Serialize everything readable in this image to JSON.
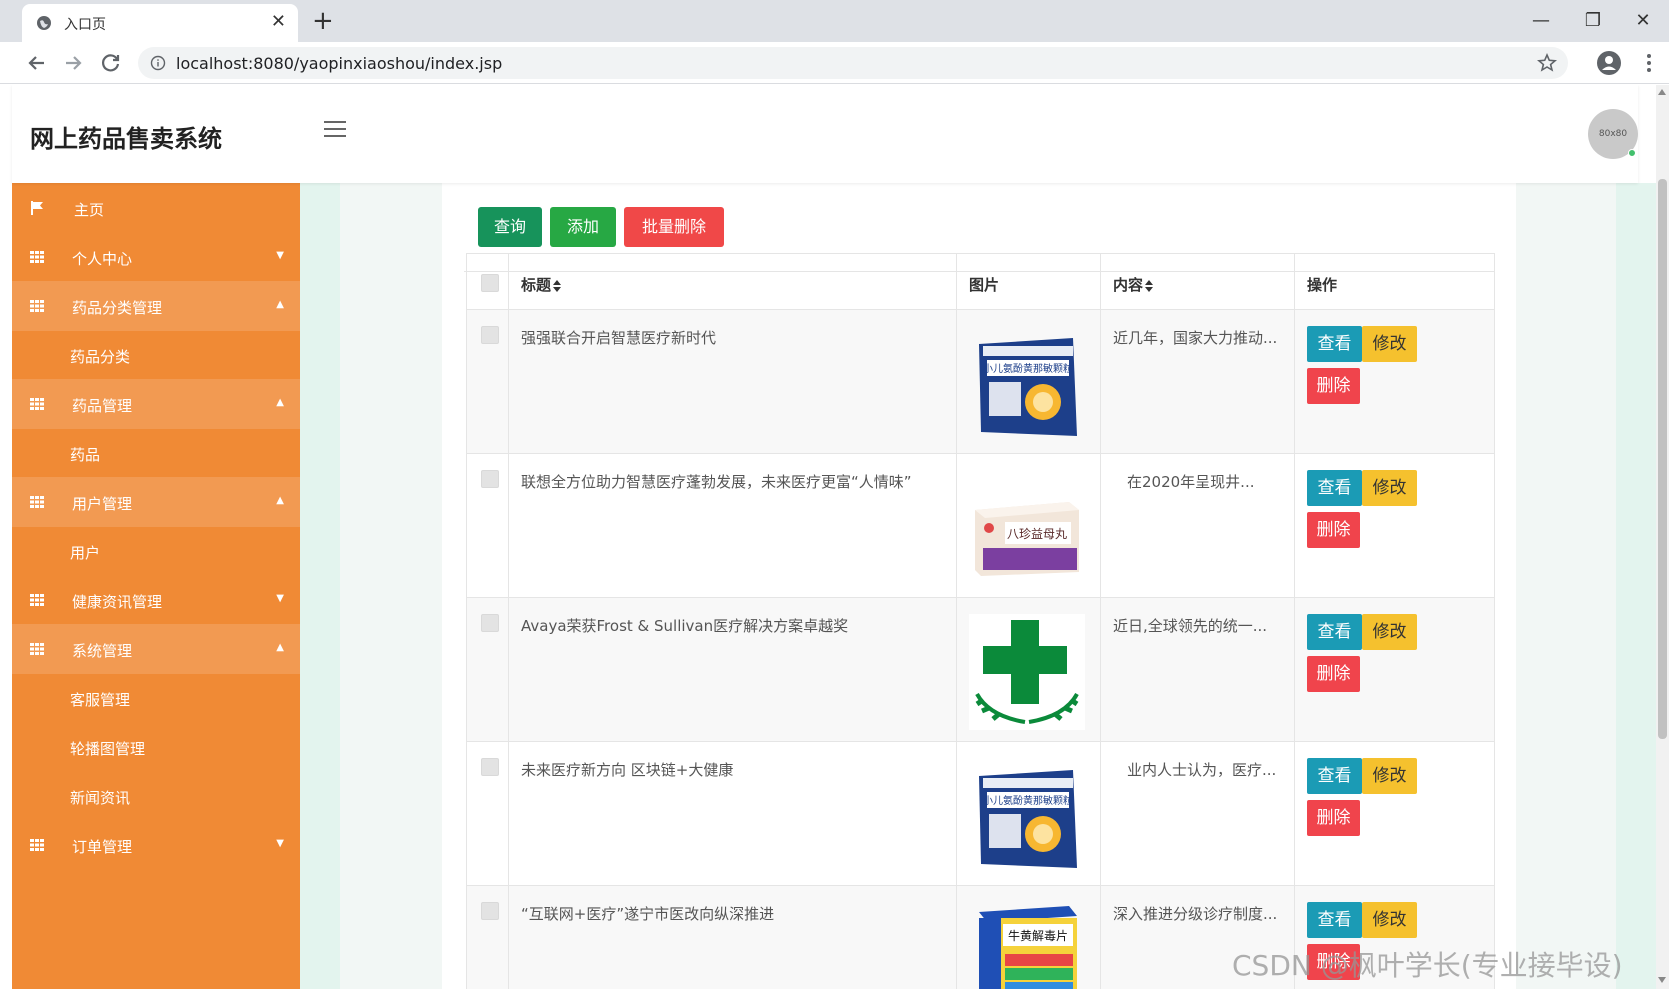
{
  "browser": {
    "tab_title": "入口页",
    "url": "localhost:8080/yaopinxiaoshou/index.jsp",
    "new_tab_symbol": "+",
    "close_symbol": "✕",
    "window_controls": {
      "minimize": "—",
      "restore": "❐",
      "close": "✕"
    }
  },
  "header": {
    "brand": "网上药品售卖系统",
    "avatar_text": "80x80"
  },
  "sidebar": {
    "items": [
      {
        "label": "主页",
        "icon": "flag-icon"
      },
      {
        "label": "个人中心",
        "icon": "grid-icon",
        "caret": "▼"
      },
      {
        "label": "药品分类管理",
        "icon": "grid-icon",
        "caret": "▲",
        "children": [
          "药品分类"
        ]
      },
      {
        "label": "药品管理",
        "icon": "grid-icon",
        "caret": "▲",
        "children": [
          "药品"
        ]
      },
      {
        "label": "用户管理",
        "icon": "grid-icon",
        "caret": "▲",
        "children": [
          "用户"
        ]
      },
      {
        "label": "健康资讯管理",
        "icon": "grid-icon",
        "caret": "▼"
      },
      {
        "label": "系统管理",
        "icon": "grid-icon",
        "caret": "▲",
        "children": [
          "客服管理",
          "轮播图管理",
          "新闻资讯"
        ]
      },
      {
        "label": "订单管理",
        "icon": "grid-icon",
        "caret": "▼"
      }
    ]
  },
  "toolbar": {
    "query": "查询",
    "add": "添加",
    "batch_delete": "批量删除"
  },
  "table": {
    "headers": {
      "title": "标题",
      "image": "图片",
      "content": "内容",
      "actions": "操作"
    },
    "rows": [
      {
        "title": "强强联合开启智慧医疗新时代",
        "content": "近几年，国家大力推动...",
        "image": "medicine-box-blue"
      },
      {
        "title": "联想全方位助力智慧医疗蓬勃发展，未来医疗更富“人情味”",
        "content": "在2020年呈现井...",
        "image": "medicine-box-purple"
      },
      {
        "title": "Avaya荣获Frost & Sullivan医疗解决方案卓越奖",
        "content": "近日,全球领先的统一...",
        "image": "green-cross"
      },
      {
        "title": "未来医疗新方向 区块链+大健康",
        "content": "业内人士认为，医疗...",
        "image": "medicine-box-blue"
      },
      {
        "title": "“互联网+医疗”遂宁市医改向纵深推进",
        "content": "深入推进分级诊疗制度...",
        "image": "medicine-box-rainbow"
      }
    ],
    "action_labels": {
      "view": "查看",
      "edit": "修改",
      "delete": "删除"
    }
  },
  "box_text": {
    "blue_box": "小儿氨酚黄那敏颗粒",
    "purple_box": "八珍益母丸",
    "rainbow_box": "牛黄解毒片"
  },
  "watermark": "CSDN @枫叶学长(专业接毕设)",
  "colors": {
    "sidebar": "#f08a35",
    "sidebar_open": "#f29a52",
    "query_button": "#17935b",
    "add_button": "#27a844",
    "delete_button": "#f04848",
    "view_button": "#1b9bb5",
    "edit_button": "#f5c12e",
    "row_delete_button": "#f0444c"
  }
}
